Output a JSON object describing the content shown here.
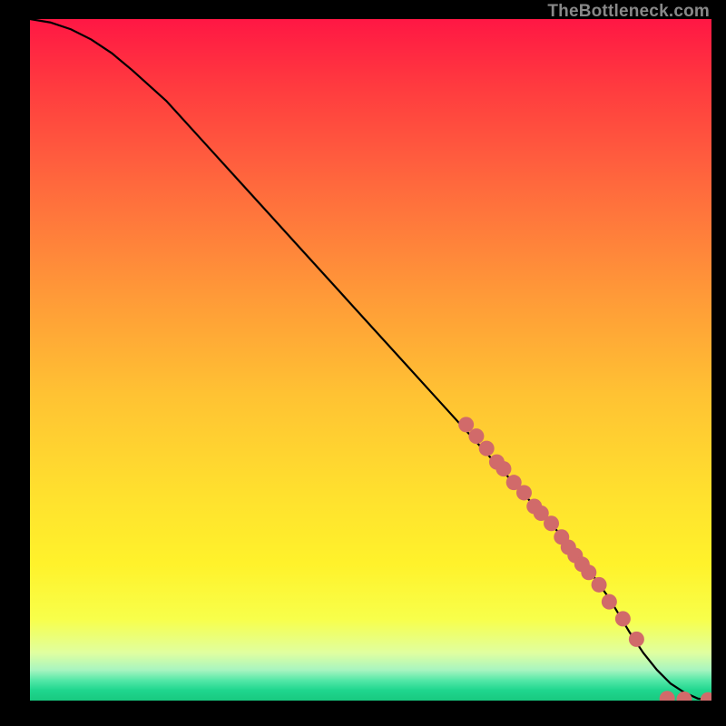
{
  "watermark": "TheBottleneck.com",
  "chart_data": {
    "type": "line",
    "title": "",
    "xlabel": "",
    "ylabel": "",
    "xlim": [
      0,
      100
    ],
    "ylim": [
      0,
      100
    ],
    "grid": false,
    "series": [
      {
        "name": "curve",
        "color": "#000000",
        "x": [
          0,
          3,
          6,
          9,
          12,
          15,
          20,
          25,
          30,
          35,
          40,
          45,
          50,
          55,
          60,
          65,
          70,
          75,
          80,
          85,
          88,
          90,
          92,
          94,
          96,
          98,
          100
        ],
        "y": [
          100,
          99.5,
          98.5,
          97,
          95,
          92.5,
          88,
          82.5,
          77,
          71.5,
          66,
          60.5,
          55,
          49.5,
          44,
          38.5,
          33,
          27.5,
          22,
          15,
          10,
          7,
          4.5,
          2.5,
          1.2,
          0.3,
          0
        ]
      },
      {
        "name": "highlight-markers",
        "color": "#d16a6a",
        "type": "scatter",
        "x": [
          64,
          65.5,
          67,
          68.5,
          69.5,
          71,
          72.5,
          74,
          75,
          76.5,
          78,
          79,
          80,
          81,
          82,
          83.5,
          85,
          87,
          89,
          93.5,
          96,
          99.5
        ],
        "y": [
          40.5,
          38.8,
          37,
          35,
          34,
          32,
          30.5,
          28.5,
          27.5,
          26,
          24,
          22.5,
          21.3,
          20,
          18.8,
          17,
          14.5,
          12,
          9,
          0.3,
          0.2,
          0.1
        ]
      }
    ],
    "background_gradient_stops": [
      {
        "pos": 0.0,
        "color": "#ff1744"
      },
      {
        "pos": 0.1,
        "color": "#ff3b3f"
      },
      {
        "pos": 0.25,
        "color": "#ff6b3d"
      },
      {
        "pos": 0.4,
        "color": "#ff9838"
      },
      {
        "pos": 0.55,
        "color": "#ffc233"
      },
      {
        "pos": 0.7,
        "color": "#ffe12e"
      },
      {
        "pos": 0.8,
        "color": "#fff22b"
      },
      {
        "pos": 0.88,
        "color": "#f8ff4a"
      },
      {
        "pos": 0.93,
        "color": "#e0ffa0"
      },
      {
        "pos": 0.955,
        "color": "#a8f5c0"
      },
      {
        "pos": 0.97,
        "color": "#55e8a8"
      },
      {
        "pos": 0.985,
        "color": "#1fd68e"
      },
      {
        "pos": 1.0,
        "color": "#18c97f"
      }
    ]
  }
}
